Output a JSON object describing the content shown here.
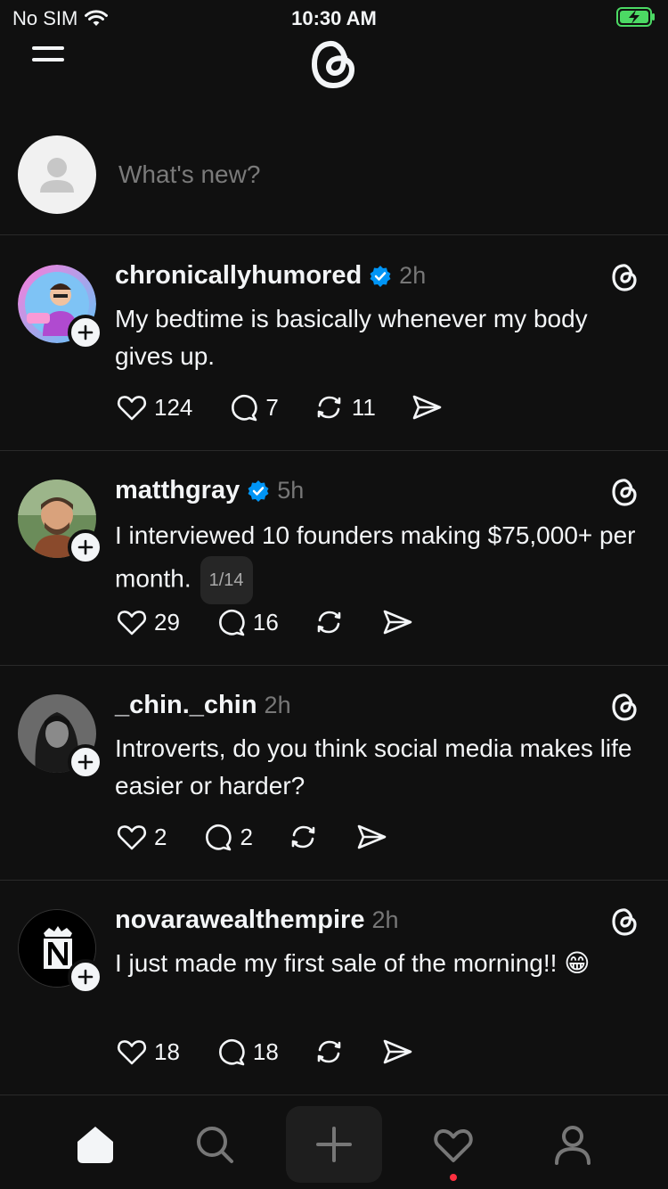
{
  "status": {
    "carrier": "No SIM",
    "time": "10:30 AM"
  },
  "composer": {
    "placeholder": "What's new?"
  },
  "posts": [
    {
      "username": "chronicallyhumored",
      "verified": true,
      "time": "2h",
      "text": "My bedtime is basically whenever my body gives up.",
      "likes": "124",
      "replies": "7",
      "reposts": "11"
    },
    {
      "username": "matthgray",
      "verified": true,
      "time": "5h",
      "text": "I interviewed 10 founders making $75,000+ per month.",
      "counter": "1/14",
      "likes": "29",
      "replies": "16"
    },
    {
      "username": "_chin._chin",
      "verified": false,
      "time": "2h",
      "text": "Introverts, do you think social media makes life easier or harder?",
      "likes": "2",
      "replies": "2"
    },
    {
      "username": "novarawealthempire",
      "verified": false,
      "time": "2h",
      "text": "I just made my first sale of the morning!! 😁",
      "likes": "18",
      "replies": "18"
    }
  ],
  "tabs": [
    "home-icon",
    "search-icon",
    "create-icon",
    "activity-icon",
    "profile-icon"
  ],
  "colors": {
    "background": "#101010",
    "verified": "#0095f6",
    "notification": "#ff3040",
    "divider": "#2a2a2a"
  }
}
